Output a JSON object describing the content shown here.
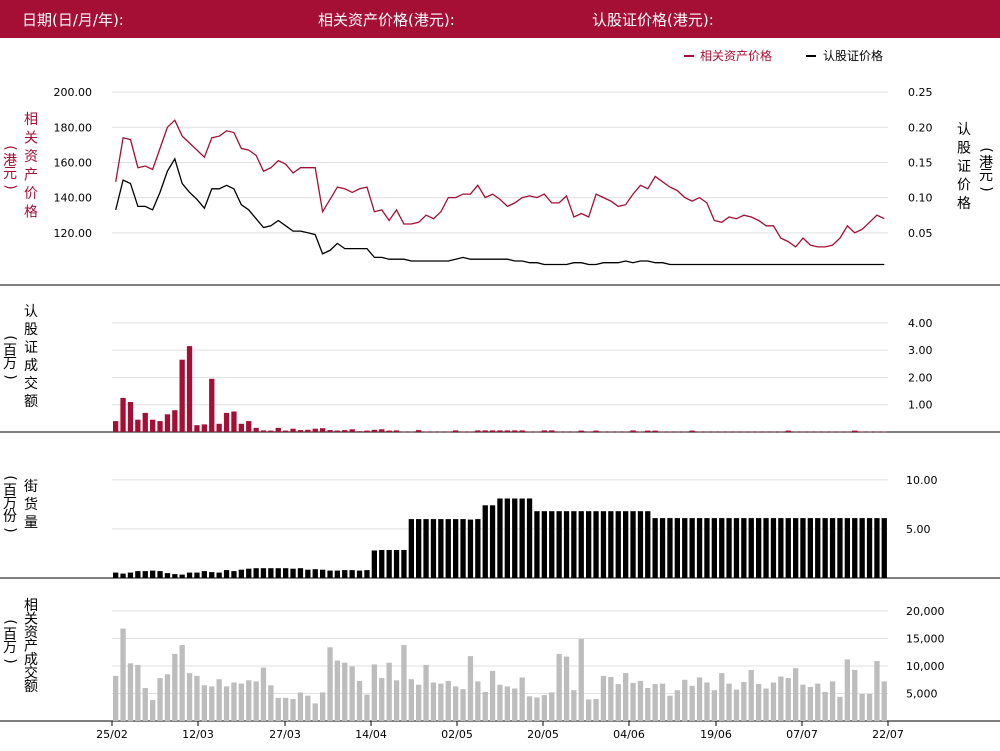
{
  "header": {
    "date_label": "日期(日/月/年):",
    "underlying_label": "相关资产价格(港元):",
    "warrant_label": "认股证价格(港元):"
  },
  "colors": {
    "brand": "#a50f35",
    "underlying": "#a50f35",
    "warrant": "#000000",
    "turnover_bar": "#a50f35",
    "street_bar": "#000000",
    "underlying_turnover_bar": "#bdbdbd",
    "grid": "#e0e0e0"
  },
  "chart_data": [
    {
      "type": "line",
      "legend": [
        "相关资产价格",
        "认股证价格"
      ],
      "legend_position": "top-right",
      "left_axis_label": "相关资产价格（港元）",
      "right_axis_label": "认股证价格（港元）",
      "left_ticks": [
        "120.00",
        "140.00",
        "160.00",
        "180.00",
        "200.00"
      ],
      "right_ticks": [
        "0.05",
        "0.10",
        "0.15",
        "0.20",
        "0.25"
      ],
      "left_ylim": [
        100,
        208
      ],
      "right_ylim": [
        0,
        0.27
      ],
      "series": [
        {
          "name": "相关资产价格",
          "axis": "left",
          "values": [
            149,
            174,
            173,
            157,
            158,
            156,
            168,
            180,
            184,
            175,
            171,
            167,
            163,
            174,
            175,
            178,
            177,
            168,
            167,
            164,
            155,
            157,
            161,
            159,
            154,
            157,
            157,
            157,
            132,
            139,
            146,
            145,
            143,
            145,
            146,
            132,
            133,
            127,
            133,
            125,
            125,
            126,
            130,
            128,
            132,
            140,
            140,
            142,
            142,
            147,
            140,
            142,
            139,
            135,
            137,
            140,
            141,
            140,
            142,
            137,
            137,
            141,
            129,
            131,
            129,
            142,
            140,
            138,
            135,
            136,
            142,
            147,
            145,
            152,
            149,
            146,
            144,
            140,
            138,
            140,
            137,
            127,
            126,
            129,
            128,
            130,
            129,
            127,
            124,
            124,
            117,
            115,
            112,
            117,
            113,
            112,
            112,
            113,
            117,
            124,
            120,
            122,
            126,
            130,
            128
          ]
        },
        {
          "name": "认股证价格",
          "axis": "left",
          "values": [
            133,
            150,
            148,
            135,
            135,
            133,
            143,
            155,
            162,
            148,
            143,
            139,
            134,
            145,
            145,
            147,
            145,
            136,
            133,
            128,
            123,
            124,
            127,
            124,
            121,
            121,
            120,
            119,
            108,
            110,
            114,
            111,
            111,
            111,
            111,
            106,
            106,
            105,
            105,
            105,
            104,
            104,
            104,
            104,
            104,
            104,
            105,
            106,
            105,
            105,
            105,
            105,
            105,
            105,
            104,
            104,
            103,
            103,
            102,
            102,
            102,
            102,
            103,
            103,
            102,
            102,
            103,
            103,
            103,
            104,
            103,
            104,
            104,
            103,
            103,
            102,
            102,
            102,
            102,
            102,
            102,
            102,
            102,
            102,
            102,
            102,
            102,
            102,
            102,
            102,
            102,
            102,
            102,
            102,
            102,
            102,
            102,
            102,
            102,
            102,
            102,
            102,
            102,
            102,
            102
          ]
        }
      ]
    },
    {
      "type": "bar",
      "axis_label": "认股证成交额（百万）",
      "ticks": [
        "1.00",
        "2.00",
        "3.00",
        "4.00"
      ],
      "ylim": [
        0,
        4.4
      ],
      "values": [
        0.4,
        1.25,
        1.1,
        0.45,
        0.7,
        0.45,
        0.4,
        0.65,
        0.8,
        2.65,
        3.15,
        0.25,
        0.28,
        1.95,
        0.3,
        0.7,
        0.75,
        0.3,
        0.4,
        0.15,
        0.06,
        0.05,
        0.15,
        0.05,
        0.12,
        0.07,
        0.08,
        0.12,
        0.14,
        0.07,
        0.05,
        0.07,
        0.1,
        0.03,
        0.05,
        0.08,
        0.1,
        0.05,
        0.06,
        0.01,
        0.01,
        0.07,
        0.01,
        0.01,
        0.01,
        0.01,
        0.06,
        0.01,
        0.01,
        0.06,
        0.06,
        0.06,
        0.06,
        0.06,
        0.06,
        0.06,
        0.01,
        0.01,
        0.06,
        0.06,
        0.01,
        0.01,
        0.01,
        0.05,
        0.01,
        0.05,
        0.01,
        0.01,
        0.01,
        0.01,
        0.06,
        0.01,
        0.05,
        0.05,
        0.01,
        0.01,
        0.01,
        0.01,
        0.05,
        0.01,
        0.01,
        0.01,
        0.01,
        0.01,
        0.01,
        0.01,
        0.01,
        0.01,
        0.01,
        0.01,
        0.01,
        0.05,
        0.01,
        0.01,
        0.01,
        0.01,
        0.01,
        0.01,
        0.01,
        0.01,
        0.05,
        0.01,
        0.01,
        0.01,
        0.01
      ]
    },
    {
      "type": "bar",
      "axis_label": "街货量（百万份）",
      "ticks": [
        "5.00",
        "10.00"
      ],
      "ylim": [
        0,
        11
      ],
      "values": [
        0.55,
        0.45,
        0.55,
        0.7,
        0.7,
        0.75,
        0.7,
        0.5,
        0.4,
        0.35,
        0.55,
        0.55,
        0.7,
        0.6,
        0.55,
        0.8,
        0.7,
        0.85,
        0.95,
        1.0,
        1.0,
        1.0,
        1.0,
        1.0,
        0.95,
        1.0,
        0.85,
        0.9,
        0.85,
        0.75,
        0.75,
        0.8,
        0.8,
        0.75,
        0.8,
        2.8,
        2.85,
        2.85,
        2.85,
        2.85,
        6.0,
        6.0,
        6.0,
        6.0,
        6.0,
        6.0,
        6.0,
        6.0,
        5.95,
        6.0,
        7.4,
        7.4,
        8.1,
        8.1,
        8.1,
        8.1,
        8.1,
        6.8,
        6.8,
        6.8,
        6.8,
        6.8,
        6.8,
        6.8,
        6.8,
        6.8,
        6.8,
        6.8,
        6.8,
        6.8,
        6.8,
        6.8,
        6.8,
        6.1,
        6.1,
        6.1,
        6.1,
        6.1,
        6.1,
        6.1,
        6.1,
        6.1,
        6.1,
        6.1,
        6.1,
        6.1,
        6.1,
        6.1,
        6.1,
        6.1,
        6.1,
        6.1,
        6.1,
        6.1,
        6.1,
        6.1,
        6.1,
        6.1,
        6.1,
        6.1,
        6.1,
        6.1,
        6.1,
        6.1,
        6.1
      ]
    },
    {
      "type": "bar",
      "axis_label": "相关资产成交额（百万）",
      "ticks": [
        "5,000",
        "10,000",
        "15,000",
        "20,000"
      ],
      "ylim": [
        0,
        22000
      ],
      "values": [
        8200,
        16800,
        10500,
        10200,
        6000,
        3800,
        7800,
        8500,
        12200,
        13800,
        8700,
        8200,
        6500,
        6300,
        7600,
        6300,
        7000,
        6800,
        7400,
        7200,
        9700,
        6500,
        4200,
        4200,
        4000,
        5200,
        4600,
        3200,
        5200,
        13400,
        11000,
        10600,
        9900,
        7300,
        4800,
        10300,
        7800,
        10600,
        7400,
        13800,
        7600,
        6600,
        10200,
        7000,
        6800,
        7300,
        6300,
        5800,
        11800,
        7200,
        5300,
        9100,
        6600,
        6300,
        5900,
        7900,
        4500,
        4300,
        4700,
        5200,
        12200,
        11700,
        5600,
        14900,
        3900,
        4000,
        8200,
        8000,
        6700,
        8700,
        6900,
        7300,
        6000,
        6700,
        6800,
        4600,
        5600,
        7500,
        6400,
        7900,
        7000,
        5600,
        8700,
        6800,
        5700,
        7100,
        9300,
        6700,
        5900,
        7000,
        8100,
        7800,
        9600,
        6600,
        6200,
        6800,
        5300,
        7200,
        4400,
        11200,
        9300,
        4900,
        4900,
        10900,
        7200
      ]
    }
  ],
  "x_ticks": [
    "25/02",
    "12/03",
    "27/03",
    "14/04",
    "02/05",
    "20/05",
    "04/06",
    "19/06",
    "07/07",
    "22/07"
  ]
}
